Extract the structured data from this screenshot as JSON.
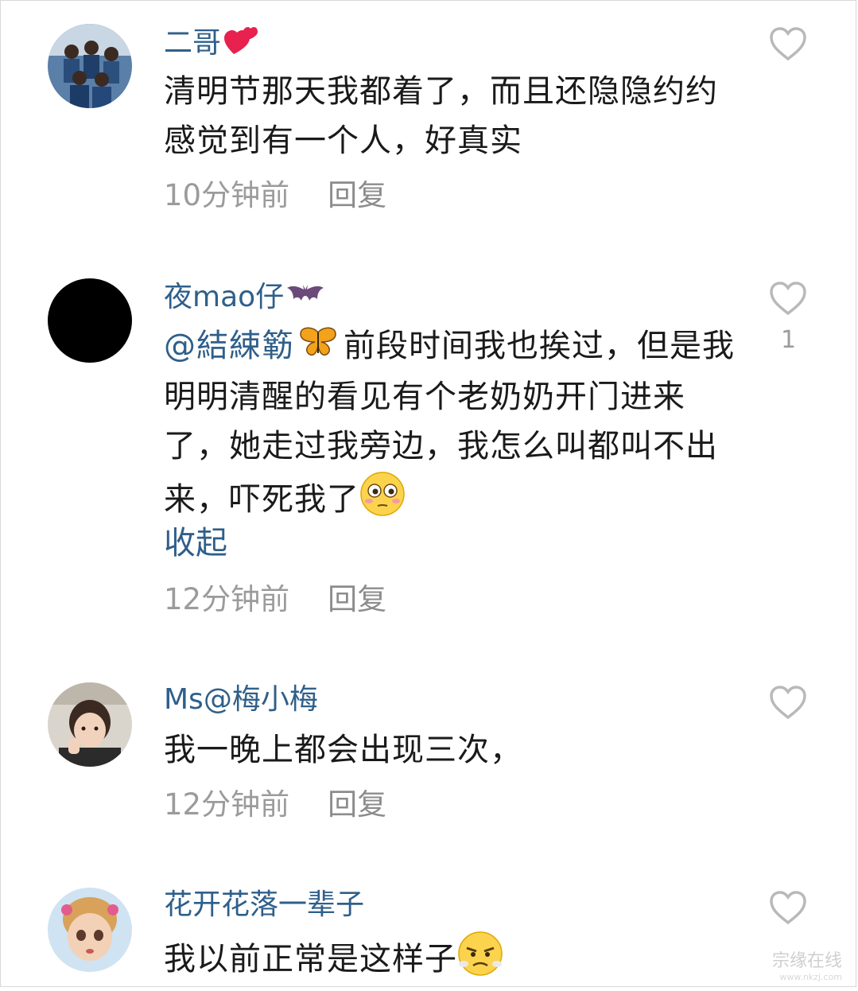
{
  "comments": [
    {
      "username": "二哥",
      "username_emoji": "two-hearts",
      "text": "清明节那天我都着了，而且还隐隐约约感觉到有一个人，好真实",
      "time": "10分钟前",
      "reply_label": "回复",
      "like_count": ""
    },
    {
      "username": "夜mao仔",
      "username_emoji": "bat",
      "mention": "@結綀簕",
      "mention_emoji": "butterfly",
      "text": "前段时间我也挨过，但是我明明清醒的看见有个老奶奶开门进来了，她走过我旁边，我怎么叫都叫不出来，吓死我了",
      "text_emoji": "flushed-face",
      "collapse_label": "收起",
      "time": "12分钟前",
      "reply_label": "回复",
      "like_count": "1"
    },
    {
      "username": "Ms@梅小梅",
      "text": "我一晚上都会出现三次，",
      "time": "12分钟前",
      "reply_label": "回复",
      "like_count": ""
    },
    {
      "username": "花开花落一辈子",
      "text": "我以前正常是这样子",
      "text_emoji": "triumph-face",
      "like_count": ""
    }
  ],
  "watermark": {
    "text": "宗缘在线",
    "url": "www.nkzj.com"
  }
}
